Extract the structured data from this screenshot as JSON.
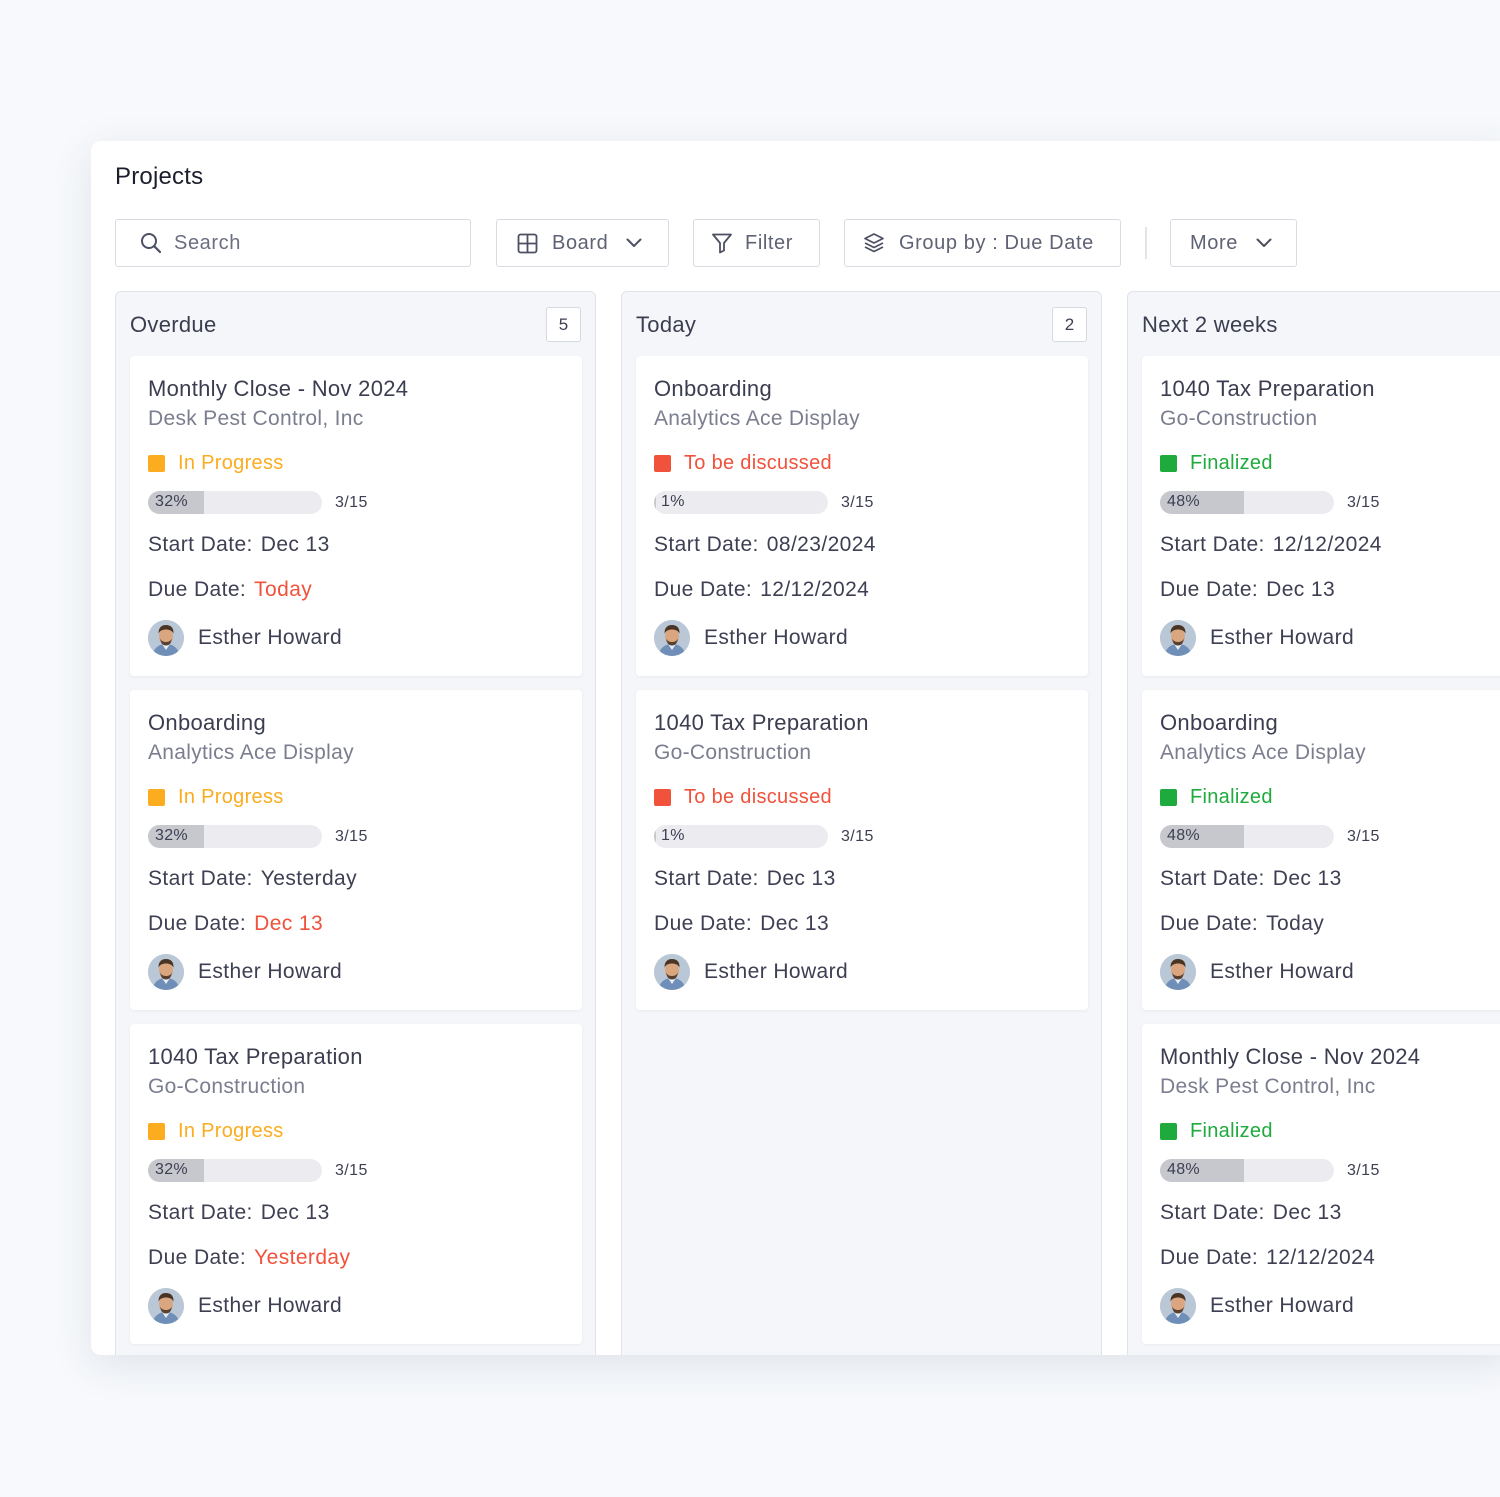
{
  "header": {
    "title": "Projects"
  },
  "toolbar": {
    "search_placeholder": "Search",
    "board_label": "Board",
    "filter_label": "Filter",
    "groupby_label": "Group by : Due Date",
    "more_label": "More"
  },
  "labels": {
    "start": "Start Date:",
    "due": "Due Date:"
  },
  "colors": {
    "in_progress": "#fbac1f",
    "to_be_discussed": "#f0523b",
    "finalized": "#1faa3e",
    "overdue_date": "#f0523b"
  },
  "icons": {
    "search": "search-icon",
    "board": "board-grid-icon",
    "filter": "filter-icon",
    "group": "layers-icon",
    "chevron": "chevron-down-icon"
  },
  "columns": [
    {
      "title": "Overdue",
      "count": "5",
      "cards": [
        {
          "name": "Monthly Close - Nov 2024",
          "client": "Desk Pest Control, Inc",
          "status": "In Progress",
          "status_key": "in_progress",
          "progress": 32,
          "progress_label": "32%",
          "tasks": "3/15",
          "start": "Dec 13",
          "due": "Today",
          "due_overdue": true,
          "assignee": "Esther Howard"
        },
        {
          "name": "Onboarding",
          "client": "Analytics Ace Display",
          "status": "In Progress",
          "status_key": "in_progress",
          "progress": 32,
          "progress_label": "32%",
          "tasks": "3/15",
          "start": "Yesterday",
          "due": "Dec 13",
          "due_overdue": true,
          "assignee": "Esther Howard"
        },
        {
          "name": "1040 Tax Preparation",
          "client": "Go-Construction",
          "status": "In Progress",
          "status_key": "in_progress",
          "progress": 32,
          "progress_label": "32%",
          "tasks": "3/15",
          "start": "Dec 13",
          "due": "Yesterday",
          "due_overdue": true,
          "assignee": "Esther Howard"
        }
      ]
    },
    {
      "title": "Today",
      "count": "2",
      "cards": [
        {
          "name": "Onboarding",
          "client": "Analytics Ace Display",
          "status": "To be discussed",
          "status_key": "to_be_discussed",
          "progress": 1,
          "progress_label": "1%",
          "tasks": "3/15",
          "start": "08/23/2024",
          "due": "12/12/2024",
          "due_overdue": false,
          "assignee": "Esther Howard"
        },
        {
          "name": "1040 Tax Preparation",
          "client": "Go-Construction",
          "status": "To be discussed",
          "status_key": "to_be_discussed",
          "progress": 1,
          "progress_label": "1%",
          "tasks": "3/15",
          "start": "Dec 13",
          "due": "Dec 13",
          "due_overdue": false,
          "assignee": "Esther Howard"
        }
      ]
    },
    {
      "title": "Next 2 weeks",
      "count": "",
      "cards": [
        {
          "name": "1040 Tax Preparation",
          "client": "Go-Construction",
          "status": "Finalized",
          "status_key": "finalized",
          "progress": 48,
          "progress_label": "48%",
          "tasks": "3/15",
          "start": "12/12/2024",
          "due": "Dec 13",
          "due_overdue": false,
          "assignee": "Esther Howard"
        },
        {
          "name": "Onboarding",
          "client": "Analytics Ace Display",
          "status": "Finalized",
          "status_key": "finalized",
          "progress": 48,
          "progress_label": "48%",
          "tasks": "3/15",
          "start": "Dec 13",
          "due": "Today",
          "due_overdue": false,
          "assignee": "Esther Howard"
        },
        {
          "name": "Monthly Close - Nov 2024",
          "client": "Desk Pest Control, Inc",
          "status": "Finalized",
          "status_key": "finalized",
          "progress": 48,
          "progress_label": "48%",
          "tasks": "3/15",
          "start": "Dec 13",
          "due": "12/12/2024",
          "due_overdue": false,
          "assignee": "Esther Howard"
        }
      ]
    }
  ]
}
